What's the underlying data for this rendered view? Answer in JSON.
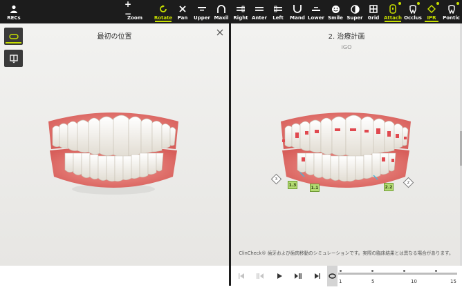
{
  "toolbar": {
    "recs_label": "RECs",
    "items": [
      {
        "label": "Zoom"
      },
      {
        "label": "Rotate"
      },
      {
        "label": "Pan"
      },
      {
        "label": "Upper"
      },
      {
        "label": "Maxil"
      },
      {
        "label": "Right"
      },
      {
        "label": "Anter"
      },
      {
        "label": "Left"
      },
      {
        "label": "Mand"
      },
      {
        "label": "Lower"
      },
      {
        "label": "Smile"
      },
      {
        "label": "Super"
      },
      {
        "label": "Grid"
      },
      {
        "label": "Attach"
      },
      {
        "label": "Occlus"
      },
      {
        "label": "IPR"
      },
      {
        "label": "Pontic"
      }
    ],
    "zoom_glyphs": "+ −",
    "accent_color": "#c8e000"
  },
  "left_panel": {
    "title": "最初の位置"
  },
  "right_panel": {
    "title": "2. 治療計画",
    "subtitle": "iGO",
    "ipr": {
      "labels": [
        "1.3",
        "1.1",
        "2.2"
      ],
      "diamonds": [
        "3",
        "2"
      ]
    },
    "disclaimer": "ClinCheck® 歯牙および歯肉移動のシミュレーションです。実際の臨床結果とは異なる場合があります。"
  },
  "timeline": {
    "ticks": [
      "1",
      "5",
      "10",
      "15"
    ]
  }
}
